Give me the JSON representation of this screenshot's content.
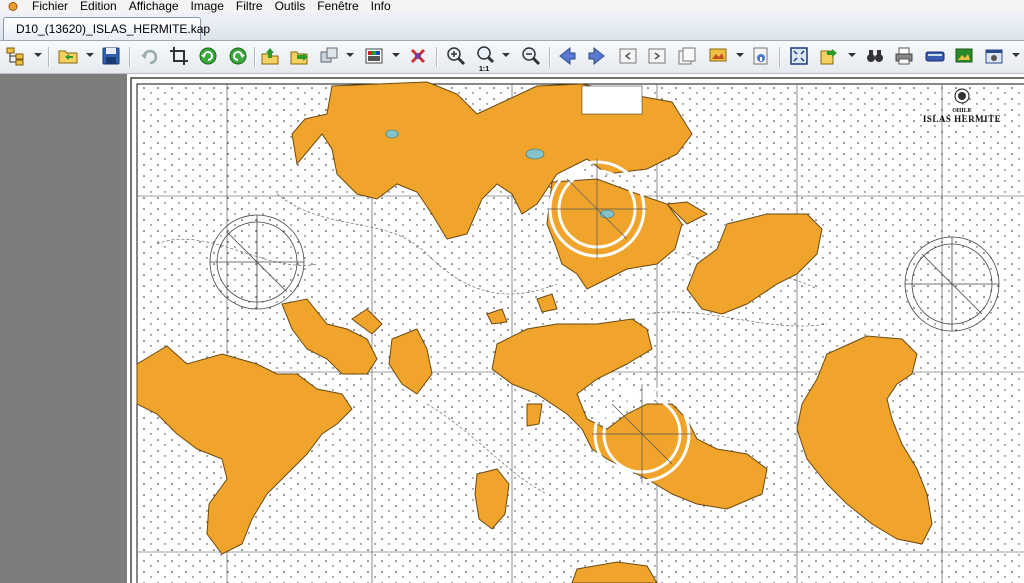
{
  "menu": {
    "items": [
      "Fichier",
      "Edition",
      "Affichage",
      "Image",
      "Filtre",
      "Outils",
      "Fenêtre",
      "Info"
    ]
  },
  "tab": {
    "title": "D10_(13620)_ISLAS_HERMITE.kap"
  },
  "toolbar": {
    "buttons": [
      "tree-view-icon",
      "open-folder-icon",
      "save-icon",
      "undo-icon",
      "crop-icon",
      "rotate-left-icon",
      "rotate-right-icon",
      "export-up-icon",
      "export-right-icon",
      "convert-icon",
      "palette-icon",
      "delete-icon",
      "zoom-in-icon",
      "zoom-actual-icon",
      "zoom-out-icon",
      "arrow-left-icon",
      "arrow-right-icon",
      "prev-page-icon",
      "next-page-icon",
      "copy-page-icon",
      "image-menu-icon",
      "info-icon",
      "fit-window-icon",
      "export-icon",
      "find-icon",
      "print-icon",
      "scanner-icon",
      "slideshow-icon",
      "screenshot-icon"
    ],
    "zoom_actual_label": "1:1"
  },
  "chart": {
    "country": "CHILE",
    "title": "ISLAS HERMITE",
    "land_color": "#f0a42b",
    "sea_color": "#ffffff",
    "coast_color": "#6b4a12"
  },
  "colors": {
    "pane_bg": "#7d7d7d",
    "toolbar_bg": "#eef1f4"
  }
}
